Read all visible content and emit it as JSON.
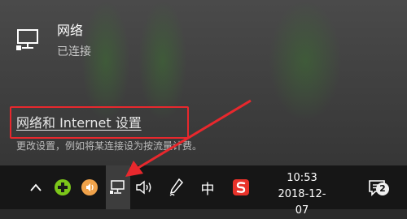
{
  "network": {
    "name": "网络",
    "status": "已连接",
    "icon": "network-ethernet-icon"
  },
  "settings": {
    "link_label": "网络和 Internet 设置",
    "description": "更改设置，例如将某连接设为按流量计费。"
  },
  "taskbar": {
    "tray_icons": [
      "chevron-up-icon",
      "plus-green-icon",
      "orange-speaker-app-icon",
      "network-icon",
      "volume-icon",
      "pen-icon",
      "ime-mode",
      "sogou-icon",
      "notification-icon"
    ],
    "ime_label": "中",
    "time": "10:53",
    "date": "2018-12-07",
    "notification_count": "2"
  },
  "colors": {
    "highlight": "#e8282d",
    "flyout_bg": "#3e3e3e",
    "taskbar_bg": "#161616"
  }
}
